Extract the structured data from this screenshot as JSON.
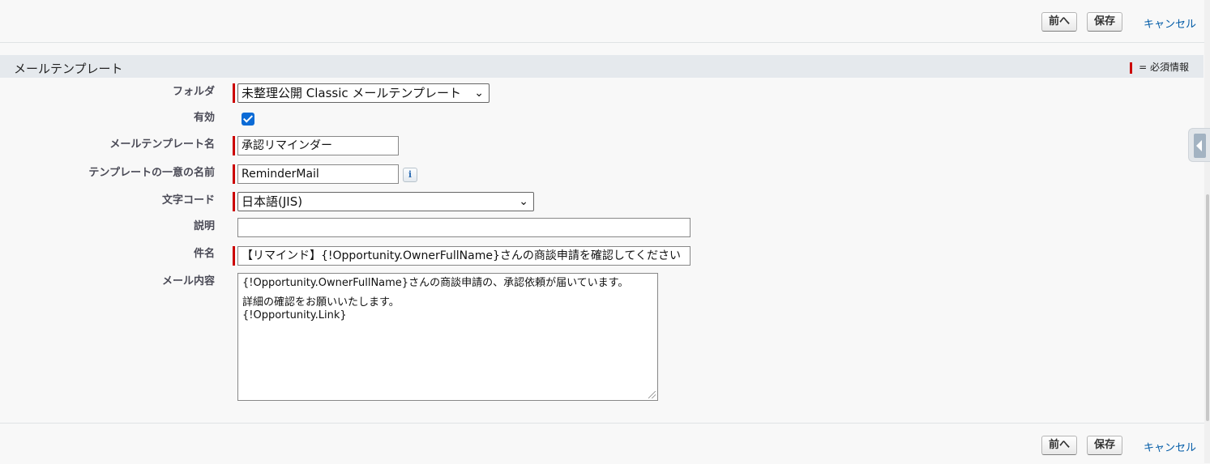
{
  "toolbar": {
    "prev_label": "前へ",
    "save_label": "保存",
    "cancel_label": "キャンセル"
  },
  "section": {
    "title": "メールテンプレート",
    "required_legend": "= 必須情報"
  },
  "fields": {
    "folder": {
      "label": "フォルダ",
      "value": "未整理公開 Classic メールテンプレート"
    },
    "active": {
      "label": "有効",
      "checked": true
    },
    "template_name": {
      "label": "メールテンプレート名",
      "value": "承認リマインダー"
    },
    "unique_name": {
      "label": "テンプレートの一意の名前",
      "value": "ReminderMail"
    },
    "encoding": {
      "label": "文字コード",
      "value": "日本語(JIS)"
    },
    "description": {
      "label": "説明",
      "value": ""
    },
    "subject": {
      "label": "件名",
      "value": "【リマインド】{!Opportunity.OwnerFullName}さんの商談申請を確認してください"
    },
    "body": {
      "label": "メール内容",
      "lines": [
        "{!Opportunity.OwnerFullName}さんの商談申請の、承認依頼が届いています。",
        "",
        "詳細の確認をお願いいたします。",
        "{!Opportunity.Link}"
      ]
    }
  },
  "icons": {
    "info": "info-icon",
    "chevron": "chevron-down-icon",
    "sidebar_toggle": "chevron-left-icon"
  },
  "colors": {
    "required": "#c00000",
    "link": "#015ba7",
    "section_bg": "#e5e9ed",
    "checkbox": "#0b6bd6"
  }
}
